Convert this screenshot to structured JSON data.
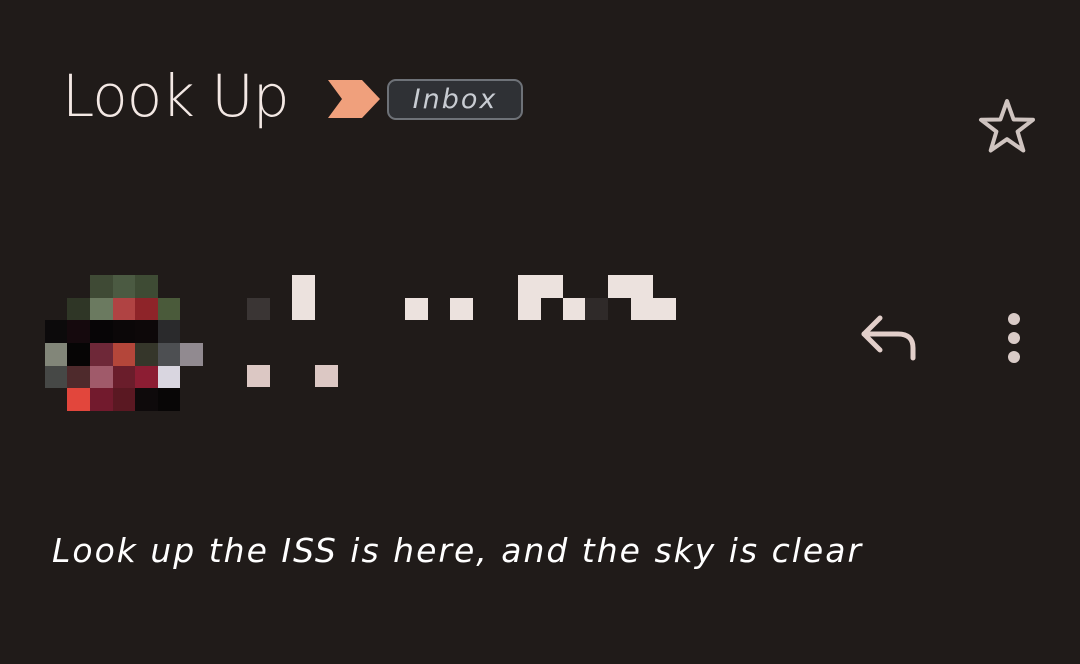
{
  "header": {
    "subject": "Look Up",
    "label": "Inbox",
    "importance_color": "#f0a07c"
  },
  "actions": {
    "star_icon": "star-outline-icon",
    "reply_icon": "reply-icon",
    "more_icon": "more-vert-icon"
  },
  "message": {
    "snippet": "Look up the ISS is here, and the sky is clear"
  },
  "colors": {
    "background": "#201b19",
    "text": "#f1e6e2",
    "chip_border": "#6e7278",
    "chip_fill": "#2f3135"
  }
}
